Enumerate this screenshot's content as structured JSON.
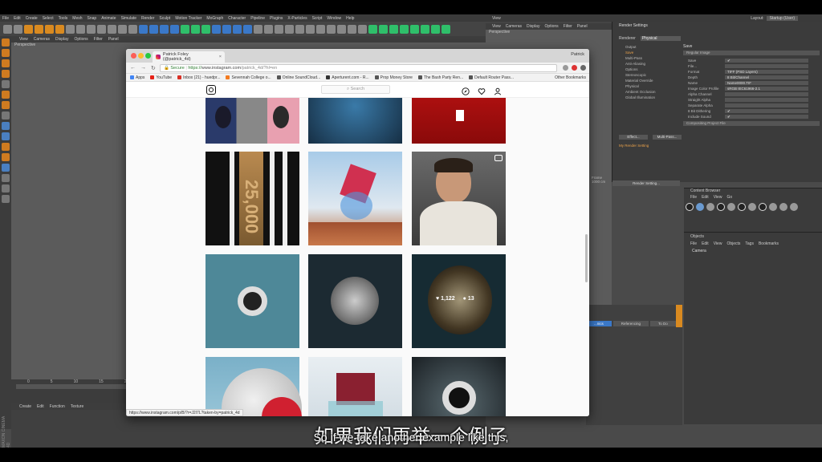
{
  "c4d": {
    "menu": [
      "File",
      "Edit",
      "Create",
      "Select",
      "Tools",
      "Mesh",
      "Snap",
      "Animate",
      "Simulate",
      "Render",
      "Sculpt",
      "Motion Tracker",
      "MoGraph",
      "Character",
      "Pipeline",
      "Plugins",
      "X-Particles",
      "Script",
      "Window",
      "Help"
    ],
    "layout_label": "Layout:",
    "layout_value": "Startup (User)",
    "viewport_menu": [
      "View",
      "Cameras",
      "Display",
      "Options",
      "Filter",
      "Panel"
    ],
    "viewport_label": "Perspective",
    "view2_title": "View",
    "view2_label": "Perspective",
    "timeline_nums": [
      "0",
      "5",
      "10",
      "15",
      "20"
    ],
    "material_menu": [
      "Create",
      "Edit",
      "Function",
      "Texture"
    ],
    "maxon_label": "MAXON CINEMA 4D"
  },
  "render_settings": {
    "title": "Render Settings",
    "renderer_label": "Renderer",
    "renderer_value": "Physical",
    "list": [
      "Output",
      "Save",
      "Multi-Pass",
      "Anti-Aliasing",
      "Options",
      "Stereoscopic",
      "Material Override",
      "Physical",
      "Ambient Occlusion",
      "Global Illumination"
    ],
    "active_item": "Save",
    "save_header": "Save",
    "regular_image": "Regular Image",
    "fields": [
      {
        "k": "Save",
        "v": "✔"
      },
      {
        "k": "File...",
        "v": ""
      },
      {
        "k": "Format",
        "v": "TIFF (PSD Layers)"
      },
      {
        "k": "Depth",
        "v": "8 Bit/Channel"
      },
      {
        "k": "Name",
        "v": "Name0000.TIF"
      },
      {
        "k": "Image Color Profile",
        "v": "sRGB IEC61966-2.1"
      },
      {
        "k": "Alpha Channel",
        "v": ""
      },
      {
        "k": "Straight Alpha",
        "v": ""
      },
      {
        "k": "Separate Alpha",
        "v": ""
      },
      {
        "k": "8 Bit Dithering",
        "v": "✔"
      },
      {
        "k": "Include Sound",
        "v": "✔"
      }
    ],
    "compositing": "Compositing Project File",
    "effect_btn": "Effect...",
    "multipass_btn": "Multi-Pass...",
    "my_setting": "My Render Setting",
    "render_btn": "Render Setting...",
    "frame_label": "Frame",
    "frame_value": "1000 cm"
  },
  "content_browser": {
    "title": "Content Browser",
    "menu": [
      "File",
      "Edit",
      "View",
      "Go"
    ]
  },
  "objects": {
    "title": "Objects",
    "menu": [
      "File",
      "Edit",
      "View",
      "Objects",
      "Tags",
      "Bookmarks"
    ],
    "camera": "Camera"
  },
  "attr_tabs": [
    "...nics",
    "Referencing",
    "To Do"
  ],
  "browser": {
    "tab_title": "Patrick Foley (@patrick_4d)",
    "user": "Patrick",
    "secure": "Secure",
    "url_prefix": "https://",
    "url_host": "www.instagram.com",
    "url_path": "/patrick_4d/?hl=en",
    "bookmarks": [
      "Apps",
      "YouTube",
      "Inbox (21) - huedpr...",
      "Sevennah College o...",
      "Online SoundCloud...",
      "Aperturent.com - R...",
      "Prop Money Store",
      "The Bash Party Ren...",
      "Default Router Pass..."
    ],
    "other_bookmarks": "Other Bookmarks",
    "status_url": "https://www.instagram.com/p/B/?r=J2I7L?taken-by=patrick_4d"
  },
  "instagram": {
    "search_placeholder": "Search",
    "hover_likes": "1,122",
    "hover_comments": "13",
    "tile_text": "25,000"
  },
  "subtitles": {
    "cn": "如果我们再举一个例子",
    "en": "So if we take another example like this,"
  }
}
